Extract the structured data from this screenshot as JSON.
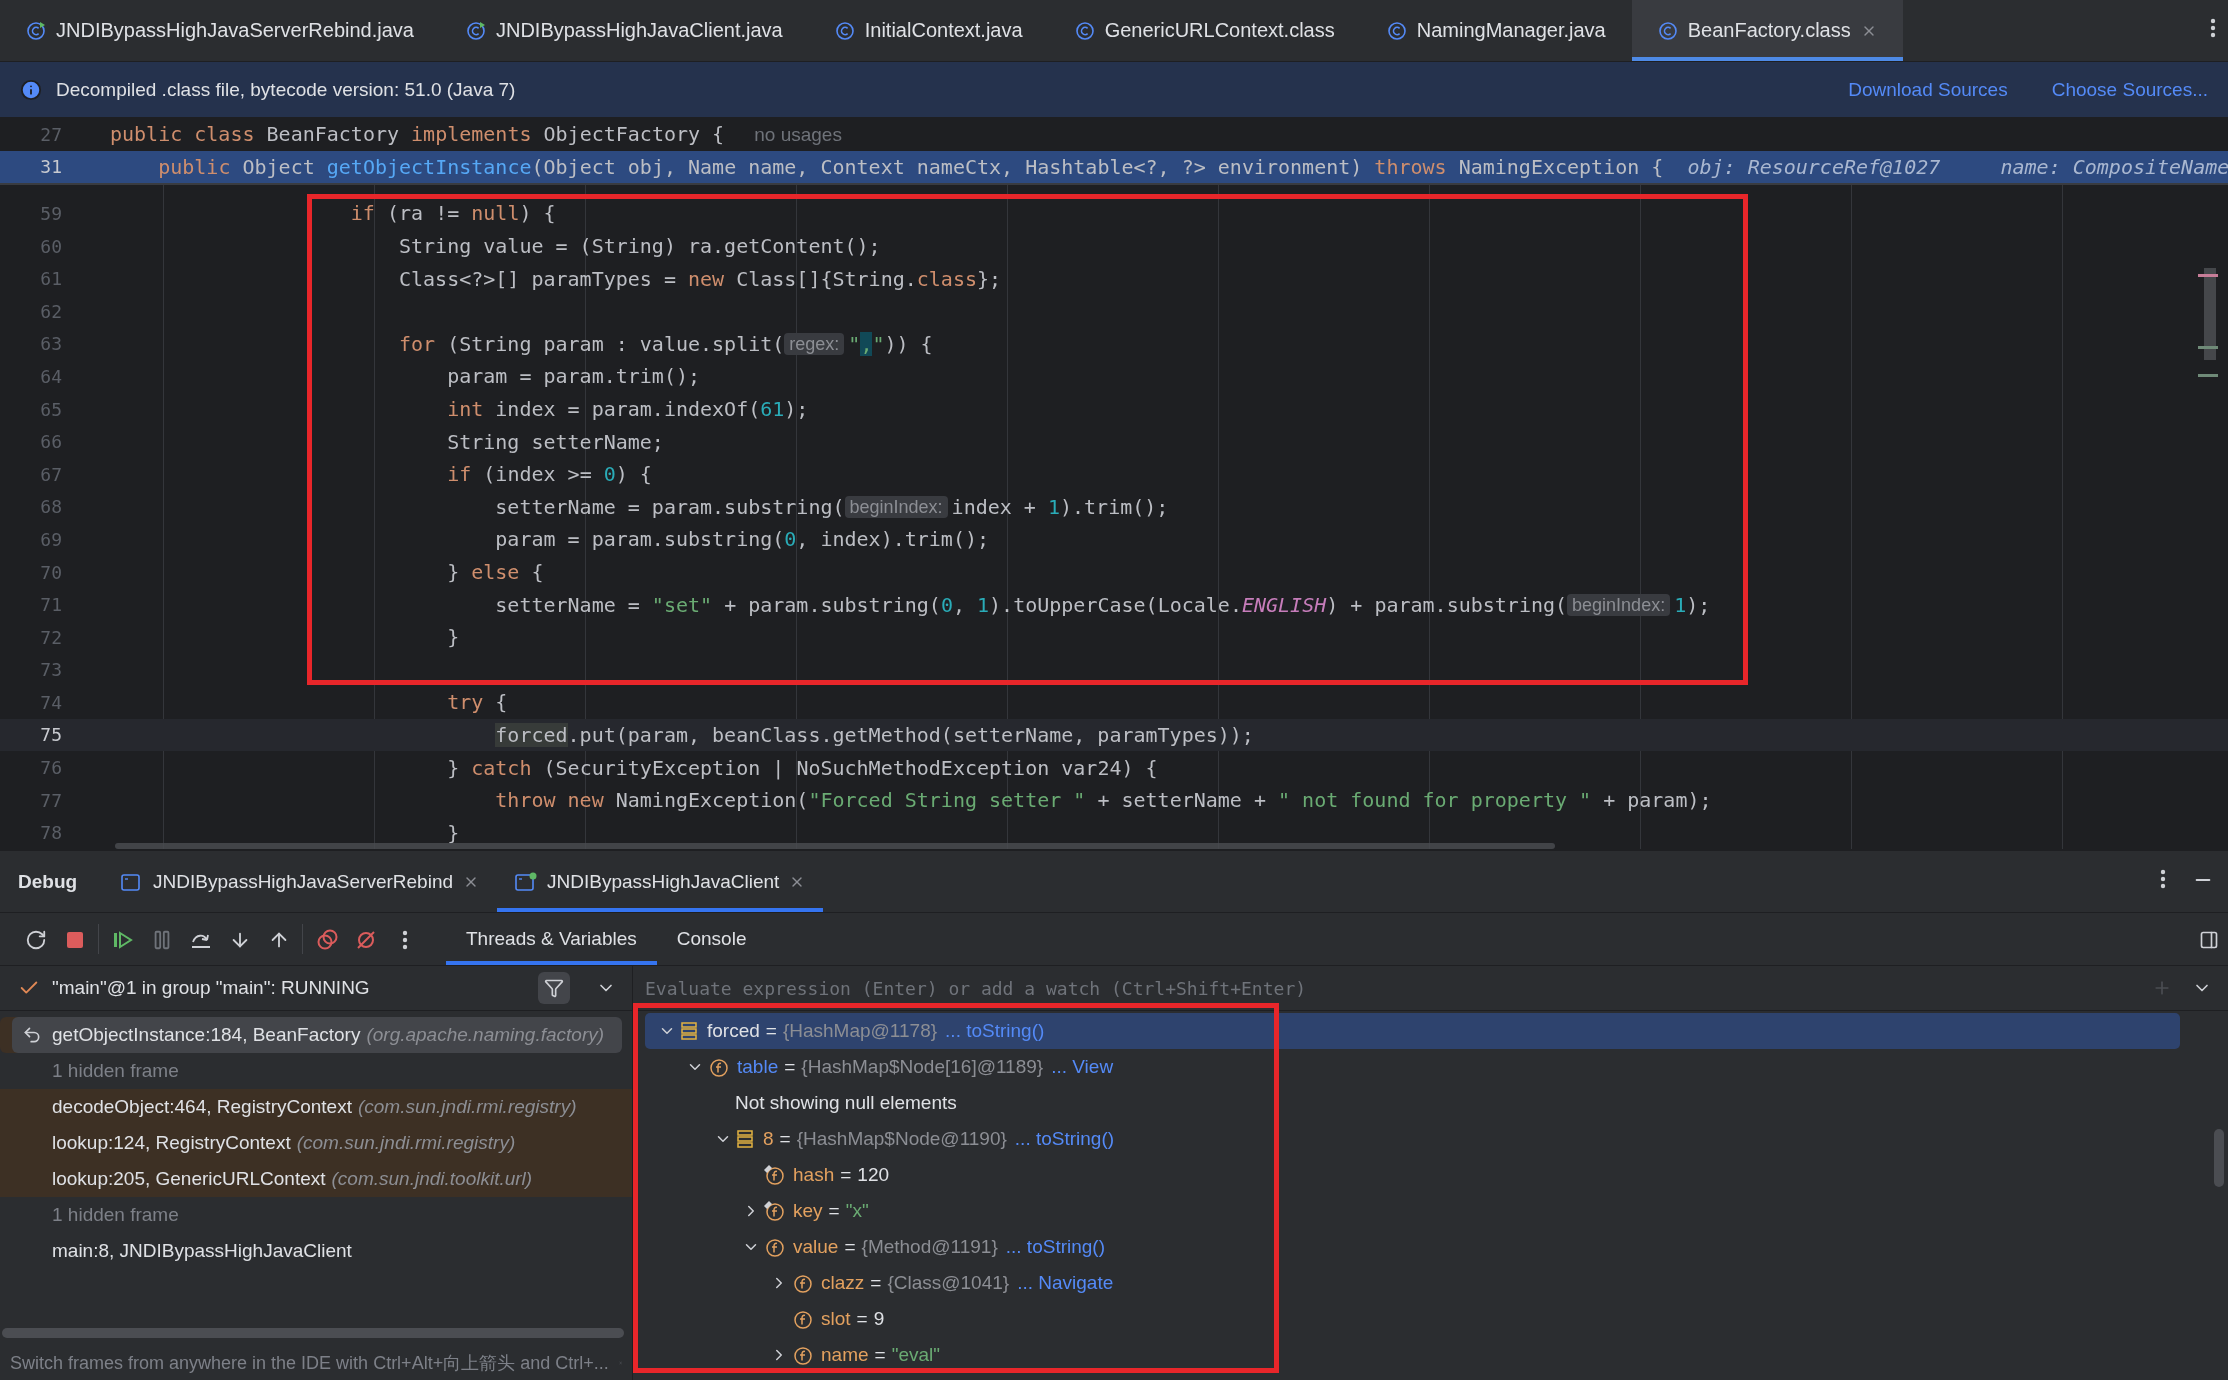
{
  "editor_tabs": [
    {
      "label": "JNDIBypassHighJavaServerRebind.java",
      "kind": "runnable",
      "selected": false
    },
    {
      "label": "JNDIBypassHighJavaClient.java",
      "kind": "runnable",
      "selected": false
    },
    {
      "label": "InitialContext.java",
      "kind": "class",
      "selected": false
    },
    {
      "label": "GenericURLContext.class",
      "kind": "class",
      "selected": false
    },
    {
      "label": "NamingManager.java",
      "kind": "class",
      "selected": false
    },
    {
      "label": "BeanFactory.class",
      "kind": "class",
      "selected": true
    }
  ],
  "banner": {
    "text": "Decompiled .class file, bytecode version: 51.0 (Java 7)",
    "links": [
      "Download Sources",
      "Choose Sources..."
    ]
  },
  "sticky_lines": [
    {
      "number": "27",
      "selected": false,
      "tokens": [
        {
          "kind": "kw",
          "text": "public class"
        },
        {
          "kind": "plain",
          "text": " BeanFactory "
        },
        {
          "kind": "kw",
          "text": "implements"
        },
        {
          "kind": "plain",
          "text": " ObjectFactory {  "
        },
        {
          "kind": "usage",
          "text": "no usages"
        }
      ]
    },
    {
      "number": "31",
      "selected": true,
      "tokens": [
        {
          "kind": "kw",
          "text": "    public"
        },
        {
          "kind": "plain",
          "text": " Object "
        },
        {
          "kind": "decl",
          "text": "getObjectInstance"
        },
        {
          "kind": "plain",
          "text": "(Object obj, Name name, Context nameCtx, Hashtable<?, ?> environment) "
        },
        {
          "kind": "kw",
          "text": "throws"
        },
        {
          "kind": "plain",
          "text": " NamingException {  "
        },
        {
          "kind": "debug",
          "text": "obj: ResourceRef@1027     name: CompositeName"
        }
      ]
    }
  ],
  "code_lines": [
    {
      "number": "59",
      "current": false,
      "tokens": [
        {
          "kind": "kw",
          "text": "                    if"
        },
        {
          "kind": "plain",
          "text": " (ra != "
        },
        {
          "kind": "kw",
          "text": "null"
        },
        {
          "kind": "plain",
          "text": ") {"
        }
      ]
    },
    {
      "number": "60",
      "current": false,
      "tokens": [
        {
          "kind": "plain",
          "text": "                        String value = (String) ra.getContent();"
        }
      ]
    },
    {
      "number": "61",
      "current": false,
      "tokens": [
        {
          "kind": "plain",
          "text": "                        Class<?>[] paramTypes = "
        },
        {
          "kind": "kw",
          "text": "new"
        },
        {
          "kind": "plain",
          "text": " Class[]{String."
        },
        {
          "kind": "kw",
          "text": "class"
        },
        {
          "kind": "plain",
          "text": "};"
        }
      ]
    },
    {
      "number": "62",
      "current": false
    },
    {
      "number": "63",
      "current": false,
      "tokens": [
        {
          "kind": "kw",
          "text": "                        for"
        },
        {
          "kind": "plain",
          "text": " (String param : value.split("
        },
        {
          "kind": "hint",
          "text": "regex:"
        },
        {
          "kind": "str",
          "text": "\""
        },
        {
          "kind": "match",
          "text": ","
        },
        {
          "kind": "str",
          "text": "\""
        },
        {
          "kind": "plain",
          "text": ")) {"
        }
      ]
    },
    {
      "number": "64",
      "current": false,
      "tokens": [
        {
          "kind": "plain",
          "text": "                            param = param.trim();"
        }
      ]
    },
    {
      "number": "65",
      "current": false,
      "tokens": [
        {
          "kind": "kw",
          "text": "                            int"
        },
        {
          "kind": "plain",
          "text": " index = param.indexOf("
        },
        {
          "kind": "num",
          "text": "61"
        },
        {
          "kind": "plain",
          "text": ");"
        }
      ]
    },
    {
      "number": "66",
      "current": false,
      "tokens": [
        {
          "kind": "plain",
          "text": "                            String setterName;"
        }
      ]
    },
    {
      "number": "67",
      "current": false,
      "tokens": [
        {
          "kind": "kw",
          "text": "                            if"
        },
        {
          "kind": "plain",
          "text": " (index >= "
        },
        {
          "kind": "num",
          "text": "0"
        },
        {
          "kind": "plain",
          "text": ") {"
        }
      ]
    },
    {
      "number": "68",
      "current": false,
      "tokens": [
        {
          "kind": "plain",
          "text": "                                setterName = param.substring("
        },
        {
          "kind": "hint",
          "text": "beginIndex:"
        },
        {
          "kind": "plain",
          "text": "index + "
        },
        {
          "kind": "num",
          "text": "1"
        },
        {
          "kind": "plain",
          "text": ").trim();"
        }
      ]
    },
    {
      "number": "69",
      "current": false,
      "tokens": [
        {
          "kind": "plain",
          "text": "                                param = param.substring("
        },
        {
          "kind": "num",
          "text": "0"
        },
        {
          "kind": "plain",
          "text": ", index).trim();"
        }
      ]
    },
    {
      "number": "70",
      "current": false,
      "tokens": [
        {
          "kind": "plain",
          "text": "                            } "
        },
        {
          "kind": "kw",
          "text": "else"
        },
        {
          "kind": "plain",
          "text": " {"
        }
      ]
    },
    {
      "number": "71",
      "current": false,
      "tokens": [
        {
          "kind": "plain",
          "text": "                                setterName = "
        },
        {
          "kind": "str",
          "text": "\"set\""
        },
        {
          "kind": "plain",
          "text": " + param.substring("
        },
        {
          "kind": "num",
          "text": "0"
        },
        {
          "kind": "plain",
          "text": ", "
        },
        {
          "kind": "num",
          "text": "1"
        },
        {
          "kind": "plain",
          "text": ").toUpperCase(Locale."
        },
        {
          "kind": "static",
          "text": "ENGLISH"
        },
        {
          "kind": "plain",
          "text": ") + param.substring("
        },
        {
          "kind": "hint",
          "text": "beginIndex:"
        },
        {
          "kind": "num",
          "text": "1"
        },
        {
          "kind": "plain",
          "text": ");"
        }
      ]
    },
    {
      "number": "72",
      "current": false,
      "tokens": [
        {
          "kind": "plain",
          "text": "                            }"
        }
      ]
    },
    {
      "number": "73",
      "current": false
    },
    {
      "number": "74",
      "current": false,
      "tokens": [
        {
          "kind": "kw",
          "text": "                            try"
        },
        {
          "kind": "plain",
          "text": " {"
        }
      ]
    },
    {
      "number": "75",
      "current": true,
      "tokens": [
        {
          "kind": "usage-mark",
          "text": "                                forced"
        },
        {
          "kind": "plain",
          "text": ".put(param, beanClass.getMethod(setterName, paramTypes));"
        }
      ]
    },
    {
      "number": "76",
      "current": false,
      "tokens": [
        {
          "kind": "plain",
          "text": "                            } "
        },
        {
          "kind": "kw",
          "text": "catch"
        },
        {
          "kind": "plain",
          "text": " (SecurityException | NoSuchMethodException var24) {"
        }
      ]
    },
    {
      "number": "77",
      "current": false,
      "tokens": [
        {
          "kind": "kw",
          "text": "                                throw new"
        },
        {
          "kind": "plain",
          "text": " NamingException("
        },
        {
          "kind": "str",
          "text": "\"Forced String setter \""
        },
        {
          "kind": "plain",
          "text": " + setterName + "
        },
        {
          "kind": "str",
          "text": "\" not found for property \""
        },
        {
          "kind": "plain",
          "text": " + param);"
        }
      ]
    },
    {
      "number": "78",
      "current": false,
      "tokens": [
        {
          "kind": "plain",
          "text": "                            }"
        }
      ]
    }
  ],
  "debug": {
    "title": "Debug",
    "sessions": [
      {
        "label": "JNDIBypassHighJavaServerRebind",
        "running": false,
        "selected": false
      },
      {
        "label": "JNDIBypassHighJavaClient",
        "running": true,
        "selected": true
      }
    ],
    "toolbar": [
      {
        "kind": "rerun",
        "disabled": false
      },
      {
        "kind": "stop",
        "disabled": false
      },
      {
        "kind": "resume",
        "disabled": false
      },
      {
        "kind": "pause",
        "disabled": true
      },
      {
        "kind": "step-over",
        "disabled": false
      },
      {
        "kind": "step-into",
        "disabled": false
      },
      {
        "kind": "step-out",
        "disabled": false
      },
      {
        "kind": "breakpoints",
        "disabled": false
      },
      {
        "kind": "mute",
        "disabled": false
      },
      {
        "kind": "more",
        "disabled": false
      }
    ],
    "view_tabs": [
      {
        "label": "Threads & Variables",
        "selected": true
      },
      {
        "label": "Console",
        "selected": false
      }
    ],
    "thread": "\"main\"@1 in group \"main\": RUNNING",
    "frames": [
      {
        "kind": "frame",
        "method": "getObjectInstance:184, BeanFactory",
        "package": "(org.apache.naming.factory)",
        "library": true,
        "selected": true
      },
      {
        "kind": "hidden",
        "method": "1 hidden frame"
      },
      {
        "kind": "frame",
        "method": "decodeObject:464, RegistryContext",
        "package": "(com.sun.jndi.rmi.registry)",
        "library": true,
        "selected": false
      },
      {
        "kind": "frame",
        "method": "lookup:124, RegistryContext",
        "package": "(com.sun.jndi.rmi.registry)",
        "library": true,
        "selected": false
      },
      {
        "kind": "frame",
        "method": "lookup:205, GenericURLContext",
        "package": "(com.sun.jndi.toolkit.url)",
        "library": true,
        "selected": false
      },
      {
        "kind": "hidden",
        "method": "1 hidden frame"
      },
      {
        "kind": "frame",
        "method": "main:8, JNDIBypassHighJavaClient",
        "library": false,
        "selected": false
      }
    ],
    "hint": "Switch frames from anywhere in the IDE with Ctrl+Alt+向上箭头 and Ctrl+...",
    "evaluate_placeholder": "Evaluate expression (Enter) or add a watch (Ctrl+Shift+Enter)",
    "variables": [
      {
        "kind": "local",
        "name": "forced",
        "sign": "=",
        "value": {
          "kind": "object",
          "text": "{HashMap@1178}"
        },
        "link": "... toString()",
        "expanded": true,
        "selected": true,
        "children": [
          {
            "kind": "field-changed",
            "name": "table",
            "sign": "=",
            "value": {
              "kind": "object",
              "text": "{HashMap$Node[16]@1189}"
            },
            "link": "... View",
            "expanded": true,
            "selected": false,
            "children": [
              {
                "kind": "message",
                "name": "Not showing null elements",
                "selected": false
              },
              {
                "kind": "element",
                "name": "8",
                "sign": "=",
                "value": {
                  "kind": "object",
                  "text": "{HashMap$Node@1190}"
                },
                "link": "... toString()",
                "expanded": true,
                "selected": false,
                "children": [
                  {
                    "kind": "final-field",
                    "name": "hash",
                    "sign": "=",
                    "value": {
                      "kind": "number",
                      "text": "120"
                    },
                    "selected": false
                  },
                  {
                    "kind": "final-field",
                    "name": "key",
                    "sign": "=",
                    "value": {
                      "kind": "string",
                      "text": "\"x\""
                    },
                    "expanded": false,
                    "selected": false
                  },
                  {
                    "kind": "field",
                    "name": "value",
                    "sign": "=",
                    "value": {
                      "kind": "object",
                      "text": "{Method@1191}"
                    },
                    "link": "... toString()",
                    "expanded": true,
                    "selected": false,
                    "children": [
                      {
                        "kind": "field",
                        "name": "clazz",
                        "sign": "=",
                        "value": {
                          "kind": "object",
                          "text": "{Class@1041}"
                        },
                        "link": "... Navigate",
                        "expanded": false,
                        "selected": false
                      },
                      {
                        "kind": "field",
                        "name": "slot",
                        "sign": "=",
                        "value": {
                          "kind": "number",
                          "text": "9"
                        },
                        "selected": false
                      },
                      {
                        "kind": "field",
                        "name": "name",
                        "sign": "=",
                        "value": {
                          "kind": "string",
                          "text": "\"eval\""
                        },
                        "expanded": false,
                        "selected": false
                      }
                    ]
                  }
                ]
              }
            ]
          }
        ]
      }
    ]
  }
}
